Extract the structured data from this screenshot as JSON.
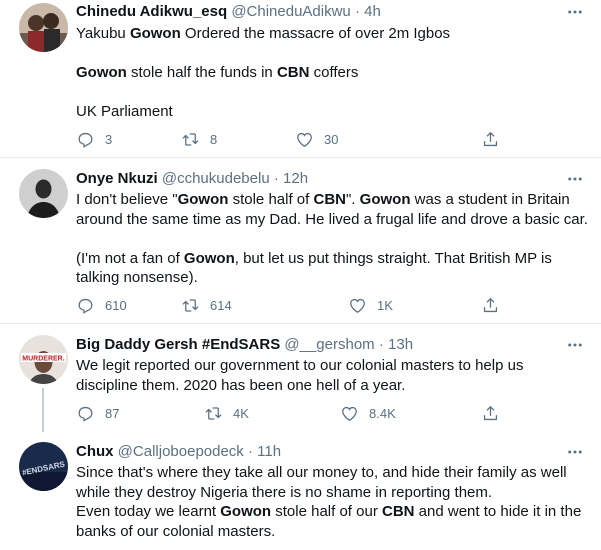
{
  "tweets": [
    {
      "name": "Chinedu Adikwu_esq",
      "handle": "@ChineduAdikwu",
      "dot": "·",
      "time": "4h",
      "lines": [
        [
          [
            "Yakubu ",
            false
          ],
          [
            "Gowon",
            true
          ],
          [
            " Ordered the massacre of over 2m Igbos",
            false
          ]
        ],
        [],
        [
          [
            "Gowon",
            true
          ],
          [
            " stole half the funds in ",
            false
          ],
          [
            "CBN",
            true
          ],
          [
            " coffers",
            false
          ]
        ],
        [],
        [
          [
            "UK Parliament",
            false
          ]
        ]
      ],
      "replies": "3",
      "retweets": "8",
      "likes": "30"
    },
    {
      "name": "Onye Nkuzi",
      "handle": "@cchukudebelu",
      "dot": "·",
      "time": "12h",
      "lines": [
        [
          [
            "I don't believe \"",
            false
          ],
          [
            "Gowon",
            true
          ],
          [
            " stole half of ",
            false
          ],
          [
            "CBN",
            true
          ],
          [
            "\". ",
            false
          ],
          [
            "Gowon",
            true
          ],
          [
            " was a student in Britain",
            false
          ]
        ],
        [
          [
            "around the same time as my Dad. He lived a frugal life and drove a basic car.",
            false
          ]
        ],
        [],
        [
          [
            "(I'm not a fan of ",
            false
          ],
          [
            "Gowon",
            true
          ],
          [
            ", but let us put things straight. That British MP is",
            false
          ]
        ],
        [
          [
            "talking nonsense).",
            false
          ]
        ]
      ],
      "replies": "610",
      "retweets": "614",
      "likes": "1K"
    },
    {
      "name": "Big Daddy Gersh #EndSARS",
      "handle": "@__gershom",
      "dot": "·",
      "time": "13h",
      "avatar_text": "MURDERER.",
      "lines": [
        [
          [
            "We legit reported our government to our colonial masters to help us",
            false
          ]
        ],
        [
          [
            "discipline them. 2020 has been one hell of a year.",
            false
          ]
        ]
      ],
      "replies": "87",
      "retweets": "4K",
      "likes": "8.4K"
    },
    {
      "name": "Chux",
      "handle": "@Calljoboepodeck",
      "dot": "·",
      "time": "11h",
      "avatar_text": "#ENDSARS",
      "lines": [
        [
          [
            "Since that's where they take all our money to, and hide their family as well",
            false
          ]
        ],
        [
          [
            "while they destroy Nigeria there is no shame in reporting them.",
            false
          ]
        ],
        [
          [
            "Even today we learnt ",
            false
          ],
          [
            "Gowon",
            true
          ],
          [
            " stole half of our ",
            false
          ],
          [
            "CBN",
            true
          ],
          [
            " and went to hide it in the",
            false
          ]
        ],
        [
          [
            "banks of our colonial masters.",
            false
          ]
        ]
      ]
    }
  ],
  "colors": {
    "text": "#0f1419",
    "muted": "#5b7083",
    "border": "#e6ecf0",
    "thread": "#c4cfd6"
  },
  "icons": {
    "more": "more-horizontal-icon",
    "reply": "reply-icon",
    "retweet": "retweet-icon",
    "like": "heart-icon",
    "share": "share-icon"
  }
}
